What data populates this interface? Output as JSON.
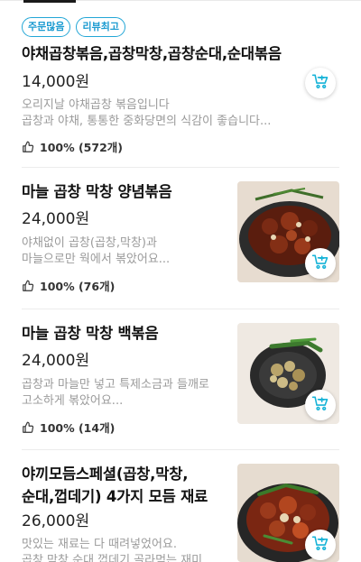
{
  "menu": {
    "items": [
      {
        "badges": [
          "주문많음",
          "리뷰최고"
        ],
        "title_lines": [
          "야채곱창볶음,곱창막창,곱창순대,순대볶음"
        ],
        "price": "14,000원",
        "desc_lines": [
          "오리지날 야채곱창 볶음입니다",
          "곱창과 야채, 통통한 중화당면의 식감이 좋습니다..."
        ],
        "rating": "100% (572개)"
      },
      {
        "title_lines": [
          "마늘 곱창 막창 양념볶음"
        ],
        "price": "24,000원",
        "desc_lines": [
          "야채없이 곱창(곱창,막창)과",
          "마늘으로만 웍에서 볶았어요..."
        ],
        "rating": "100% (76개)"
      },
      {
        "title_lines": [
          "마늘 곱창 막창 백볶음"
        ],
        "price": "24,000원",
        "desc_lines": [
          "곱창과 마늘만 넣고 특제소금과 들깨로",
          "고소하게 볶았어요..."
        ],
        "rating": "100% (14개)"
      },
      {
        "title_lines": [
          "야끼모듬스페셜(곱창,막창,",
          "순대,껍데기) 4가지 모듬 재료"
        ],
        "price": "26,000원",
        "desc_lines": [
          "맛있는 재료는 다 때려넣었어요.",
          "곱창,막창,순대,껍데기 골라먹는 재미"
        ]
      }
    ]
  },
  "icons": {
    "cart": "add-to-cart-icon",
    "thumb": "thumbs-up-icon"
  },
  "colors": {
    "badge": "#1b9bd1",
    "cart_accent": "#18b4d8"
  }
}
